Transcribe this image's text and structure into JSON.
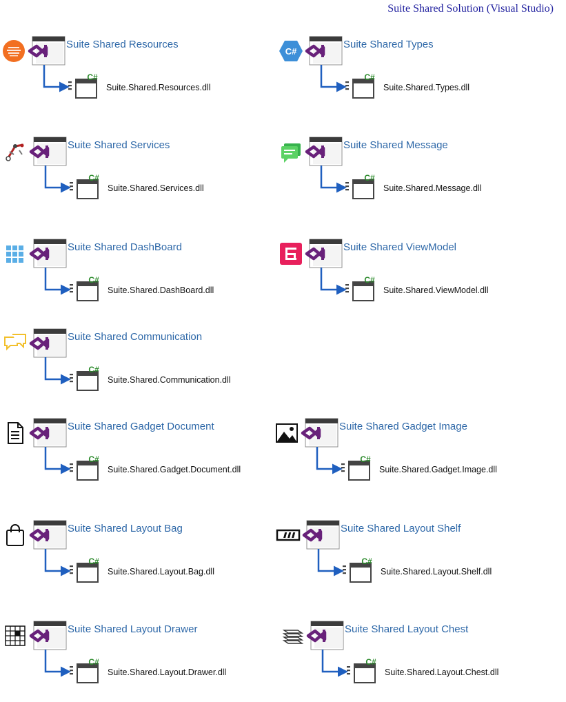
{
  "title": "Suite Shared Solution (Visual Studio)",
  "colors": {
    "link": "#2e68a8",
    "arrow": "#1f5fbf",
    "vs_purple": "#68217a",
    "csharp_green": "#2b8a2b"
  },
  "projects": [
    {
      "name": "Suite Shared Resources",
      "dll": "Suite.Shared.Resources.dll",
      "icon": "resources-icon"
    },
    {
      "name": "Suite Shared Types",
      "dll": "Suite.Shared.Types.dll",
      "icon": "csharp-hex-icon"
    },
    {
      "name": "Suite Shared Services",
      "dll": "Suite.Shared.Services.dll",
      "icon": "services-icon"
    },
    {
      "name": "Suite Shared Message",
      "dll": "Suite.Shared.Message.dll",
      "icon": "message-icon"
    },
    {
      "name": "Suite Shared DashBoard",
      "dll": "Suite.Shared.DashBoard.dll",
      "icon": "dashboard-grid-icon"
    },
    {
      "name": "Suite Shared ViewModel",
      "dll": "Suite.Shared.ViewModel.dll",
      "icon": "viewmodel-icon"
    },
    {
      "name": "Suite Shared Communication",
      "dll": "Suite.Shared.Communication.dll",
      "icon": "chat-bubbles-icon"
    },
    {
      "name": "Suite Shared Gadget Document",
      "dll": "Suite.Shared.Gadget.Document.dll",
      "icon": "document-icon"
    },
    {
      "name": "Suite Shared Gadget Image",
      "dll": "Suite.Shared.Gadget.Image.dll",
      "icon": "image-icon"
    },
    {
      "name": "Suite Shared Layout Bag",
      "dll": "Suite.Shared.Layout.Bag.dll",
      "icon": "bag-icon"
    },
    {
      "name": "Suite Shared Layout Shelf",
      "dll": "Suite.Shared.Layout.Shelf.dll",
      "icon": "shelf-icon"
    },
    {
      "name": "Suite Shared Layout Drawer",
      "dll": "Suite.Shared.Layout.Drawer.dll",
      "icon": "drawer-grid-icon"
    },
    {
      "name": "Suite Shared Layout Chest",
      "dll": "Suite.Shared.Layout.Chest.dll",
      "icon": "chest-stack-icon"
    }
  ]
}
